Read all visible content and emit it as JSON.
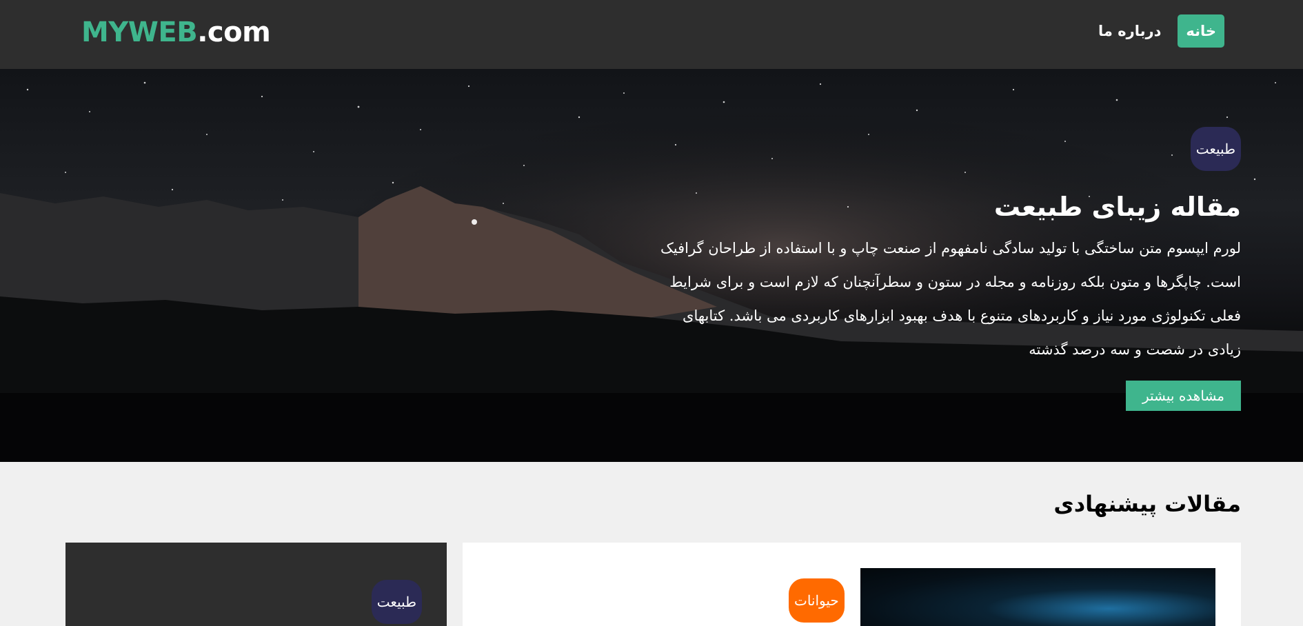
{
  "header": {
    "logo_brand": "MYWEB",
    "logo_tld": ".com",
    "nav": [
      {
        "label": "خانه",
        "active": true
      },
      {
        "label": "درباره ما",
        "active": false
      }
    ]
  },
  "hero": {
    "category": "طبیعت",
    "title": "مقاله زیبای طبیعت",
    "text": "لورم ایپسوم متن ساختگی با تولید سادگی نامفهوم از صنعت چاپ و با استفاده از طراحان گرافیک است. چاپگرها و متون بلکه روزنامه و مجله در ستون و سطرآنچنان که لازم است و برای شرایط فعلی تکنولوژی مورد نیاز و کاربردهای متنوع با هدف بهبود ابزارهای کاربردی می باشد. کتابهای زیادی در شصت و سه درصد گذشته",
    "button": "مشاهده بیشتر"
  },
  "suggested": {
    "title": "مقالات پیشنهادی",
    "cards": [
      {
        "category": "حیوانات"
      },
      {
        "category": "طبیعت"
      }
    ]
  },
  "colors": {
    "accent": "#3fb58d",
    "header_bg": "#2e2e2e",
    "badge_nature": "#2b2a55",
    "badge_animals": "#ff6a00"
  }
}
